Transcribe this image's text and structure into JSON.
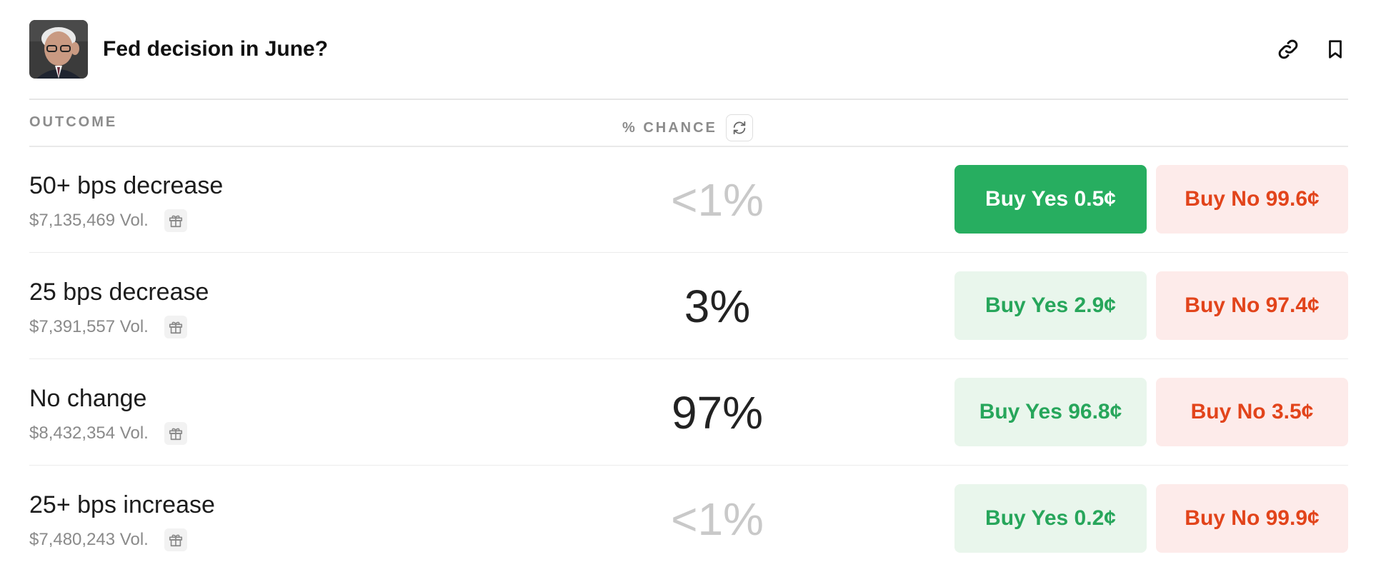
{
  "market": {
    "title": "Fed decision in June?"
  },
  "columns": {
    "outcome": "OUTCOME",
    "chance": "% CHANCE"
  },
  "rows": [
    {
      "name": "50+ bps decrease",
      "volume": "$7,135,469 Vol.",
      "chance": "<1%",
      "yes": "Buy Yes 0.5¢",
      "no": "Buy No 99.6¢"
    },
    {
      "name": "25 bps decrease",
      "volume": "$7,391,557 Vol.",
      "chance": "3%",
      "yes": "Buy Yes 2.9¢",
      "no": "Buy No 97.4¢"
    },
    {
      "name": "No change",
      "volume": "$8,432,354 Vol.",
      "chance": "97%",
      "yes": "Buy Yes 96.8¢",
      "no": "Buy No 3.5¢"
    },
    {
      "name": "25+ bps increase",
      "volume": "$7,480,243 Vol.",
      "chance": "<1%",
      "yes": "Buy Yes 0.2¢",
      "no": "Buy No 99.9¢"
    }
  ],
  "icons": {
    "link": "link-icon",
    "bookmark": "bookmark-icon",
    "refresh": "refresh-icon",
    "gift": "gift-icon"
  },
  "colors": {
    "yes_active_bg": "#27ae60",
    "yes_bg": "#e9f6ec",
    "yes_text": "#27a65b",
    "no_bg": "#fdebea",
    "no_text": "#e2441b"
  }
}
